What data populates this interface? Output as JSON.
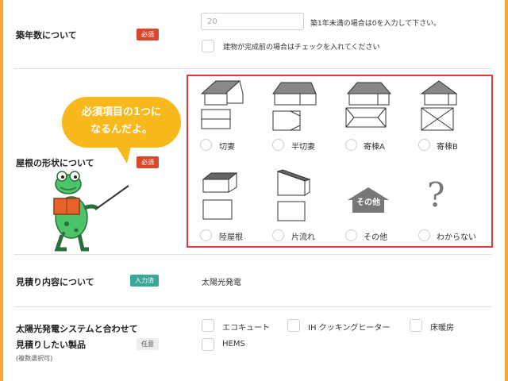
{
  "row1": {
    "label": "築年数について",
    "badge": "必須",
    "input_value": "20",
    "hint": "築1年未満の場合は0を入力して下さい。",
    "checkbox_label": "建物が完成前の場合はチェックを入れてください"
  },
  "row2": {
    "label": "屋根の形状について",
    "badge": "必須",
    "bubble_line1": "必須項目の1つに",
    "bubble_line2": "なるんだよ。",
    "options": [
      {
        "label": "切妻",
        "icon": "gable-roof-icon"
      },
      {
        "label": "半切妻",
        "icon": "half-gable-roof-icon"
      },
      {
        "label": "寄棟A",
        "icon": "hip-roof-a-icon"
      },
      {
        "label": "寄棟B",
        "icon": "hip-roof-b-icon"
      },
      {
        "label": "陸屋根",
        "icon": "flat-roof-icon"
      },
      {
        "label": "片流れ",
        "icon": "shed-roof-icon"
      },
      {
        "label": "その他",
        "icon": "other-house-icon"
      },
      {
        "label": "わからない",
        "icon": "question-mark-icon"
      }
    ],
    "other_icon_text": "その他",
    "unknown_icon_text": "?"
  },
  "row3": {
    "label": "見積り内容について",
    "badge": "入力済",
    "value": "太陽光発電"
  },
  "row4": {
    "label_line1": "太陽光発電システムと合わせて",
    "label_line2": "見積りしたい製品",
    "badge": "任意",
    "note": "(複数選択可)",
    "options": [
      "エコキュート",
      "IH クッキングヒーター",
      "床暖房",
      "HEMS"
    ]
  },
  "colors": {
    "accent": "#f7a73a",
    "required": "#d9472b",
    "done": "#3aa899",
    "highlight": "#e53935",
    "bubble": "#f9b81b",
    "frog": "#4cc46a"
  }
}
